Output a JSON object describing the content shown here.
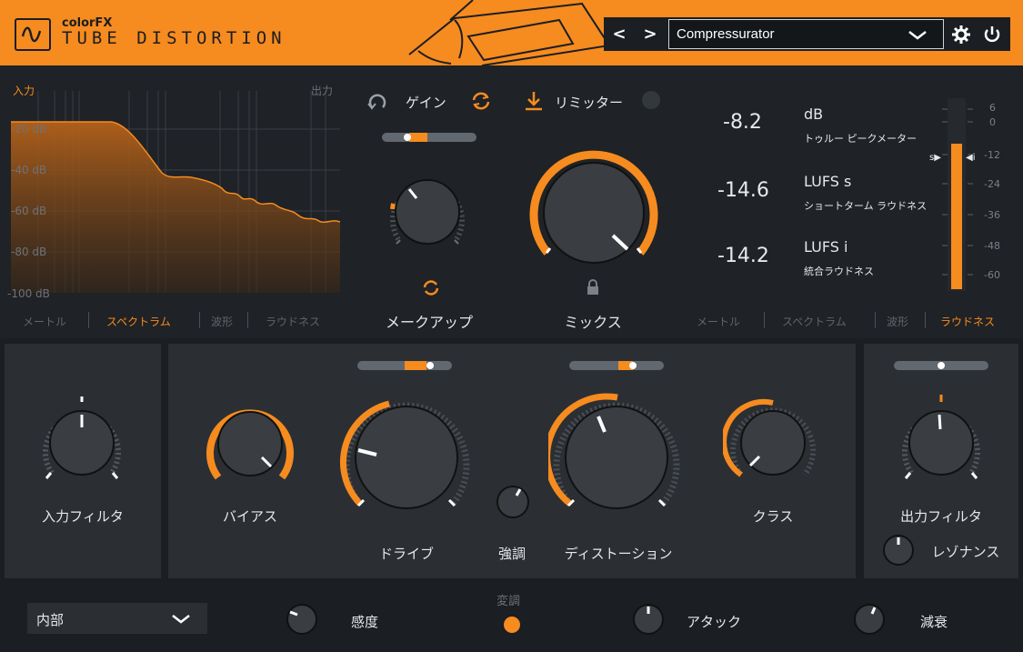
{
  "header": {
    "brand": "colorFX",
    "product": "TUBE DISTORTION",
    "prev_label": "<",
    "next_label": ">",
    "preset_name": "Compressurator"
  },
  "spectrum": {
    "input_label": "入力",
    "output_label": "出力",
    "db_ticks": [
      "-20 dB",
      "-40 dB",
      "-60 dB",
      "-80 dB",
      "-100 dB"
    ],
    "tabs": [
      "メートル",
      "スペクトラム",
      "波形",
      "ラウドネス"
    ],
    "active_tab": "スペクトラム"
  },
  "gain": {
    "gain_label": "ゲイン",
    "limiter_label": "リミッター",
    "makeup_label": "メークアップ",
    "mix_label": "ミックス"
  },
  "meters": {
    "rows": [
      {
        "value": "-8.2",
        "unit": "dB",
        "desc": "トゥルー ピークメーター"
      },
      {
        "value": "-14.6",
        "unit": "LUFS s",
        "desc": "ショートターム ラウドネス"
      },
      {
        "value": "-14.2",
        "unit": "LUFS i",
        "desc": "統合ラウドネス"
      }
    ],
    "scale": [
      "6",
      "0",
      "-12",
      "-24",
      "-36",
      "-48",
      "-60"
    ],
    "s_marker": "s",
    "i_marker": "i",
    "tabs": [
      "メートル",
      "スペクトラム",
      "波形",
      "ラウドネス"
    ],
    "active_tab": "ラウドネス"
  },
  "knobs": {
    "input_filter": "入力フィルタ",
    "bias": "バイアス",
    "drive": "ドライブ",
    "emphasis": "強調",
    "distortion": "ディストーション",
    "class": "クラス",
    "output_filter": "出力フィルタ",
    "resonance": "レゾナンス"
  },
  "footer": {
    "source_select": "内部",
    "sensitivity": "感度",
    "modulation": "変調",
    "attack": "アタック",
    "decay": "減衰"
  },
  "colors": {
    "accent": "#f68b1f",
    "bg": "#1b1e22",
    "panel": "#2b2f34"
  }
}
